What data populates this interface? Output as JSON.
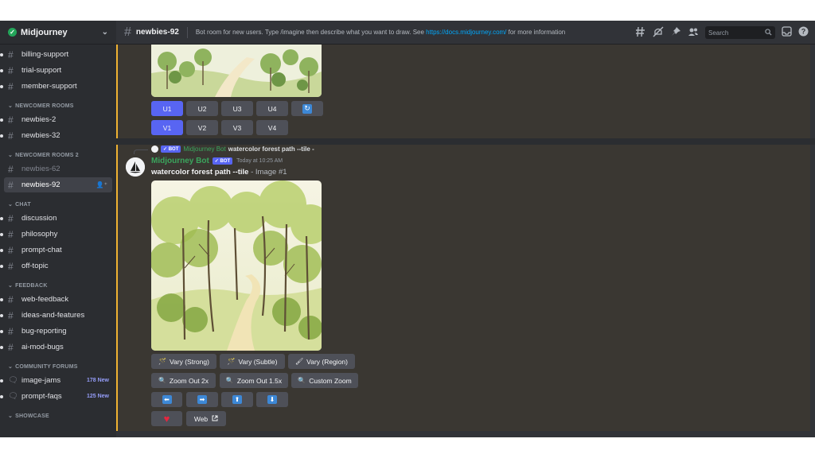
{
  "server": {
    "name": "Midjourney",
    "verified_glyph": "✓",
    "chevron": "⌄"
  },
  "sidebar": {
    "top_channels": [
      {
        "name": "billing-support"
      },
      {
        "name": "trial-support"
      },
      {
        "name": "member-support"
      }
    ],
    "categories": [
      {
        "label": "NEWCOMER ROOMS",
        "channels": [
          {
            "name": "newbies-2"
          },
          {
            "name": "newbies-32"
          }
        ]
      },
      {
        "label": "NEWCOMER ROOMS 2",
        "channels": [
          {
            "name": "newbies-62"
          },
          {
            "name": "newbies-92"
          }
        ]
      },
      {
        "label": "CHAT",
        "channels": [
          {
            "name": "discussion"
          },
          {
            "name": "philosophy"
          },
          {
            "name": "prompt-chat"
          },
          {
            "name": "off-topic"
          }
        ]
      },
      {
        "label": "FEEDBACK",
        "channels": [
          {
            "name": "web-feedback"
          },
          {
            "name": "ideas-and-features"
          },
          {
            "name": "bug-reporting"
          },
          {
            "name": "ai-mod-bugs"
          }
        ]
      },
      {
        "label": "COMMUNITY FORUMS",
        "channels": [
          {
            "name": "image-jams",
            "badge": "178 New"
          },
          {
            "name": "prompt-faqs",
            "badge": "125 New"
          }
        ]
      },
      {
        "label": "SHOWCASE",
        "channels": []
      }
    ]
  },
  "topbar": {
    "channel_name": "newbies-92",
    "topic_prefix": "Bot room for new users. Type /imagine then describe what you want to draw. See ",
    "topic_link": "https://docs.midjourney.com/",
    "topic_suffix": " for more information",
    "search_placeholder": "Search"
  },
  "msg1": {
    "upscale_buttons": [
      "U1",
      "U2",
      "U3",
      "U4"
    ],
    "variation_buttons": [
      "V1",
      "V2",
      "V3",
      "V4"
    ],
    "reroll_glyph": "↻"
  },
  "msg2": {
    "bot_tag": "✓ BOT",
    "reply_author": "Midjourney Bot",
    "reply_text": "watercolor forest path --tile -",
    "author": "Midjourney Bot",
    "timestamp": "Today at 10:25 AM",
    "prompt": "watercolor forest path --tile",
    "suffix": " - Image #1",
    "buttons": {
      "vary_strong": "Vary (Strong)",
      "vary_subtle": "Vary (Subtle)",
      "vary_region": "Vary (Region)",
      "zoom_out_2x": "Zoom Out 2x",
      "zoom_out_15x": "Zoom Out 1.5x",
      "custom_zoom": "Custom Zoom",
      "pan_left": "⬅",
      "pan_right": "➡",
      "pan_up": "⬆",
      "pan_down": "⬇",
      "favorite": "♥",
      "web": "Web"
    }
  },
  "colors": {
    "accent": "#5865f2",
    "highlight_bar": "#f0b232",
    "bot_green": "#3ba55d",
    "link": "#00a8fc"
  }
}
